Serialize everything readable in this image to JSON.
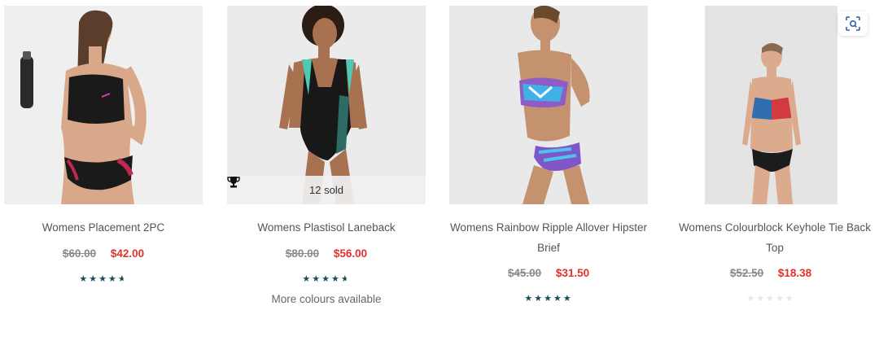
{
  "products": [
    {
      "name": "Womens Placement 2PC",
      "old_price": "$60.00",
      "new_price": "$42.00",
      "rating_stars": 4.5,
      "sold_badge": null,
      "extra_note": null
    },
    {
      "name": "Womens Plastisol Laneback",
      "old_price": "$80.00",
      "new_price": "$56.00",
      "rating_stars": 4.5,
      "sold_badge": "12 sold",
      "extra_note": "More colours available"
    },
    {
      "name": "Womens Rainbow Ripple Allover Hipster Brief",
      "old_price": "$45.00",
      "new_price": "$31.50",
      "rating_stars": 5,
      "sold_badge": null,
      "extra_note": null
    },
    {
      "name": "Womens Colourblock Keyhole Tie Back Top",
      "old_price": "$52.50",
      "new_price": "$18.38",
      "rating_stars": 0,
      "sold_badge": null,
      "extra_note": null
    }
  ],
  "icons": {
    "trophy": "trophy-icon",
    "visual_search": "visual-search-icon"
  },
  "colors": {
    "sale_price": "#e0322e",
    "old_price": "#8a8a8a",
    "star_filled": "#14505a",
    "star_empty": "#e6e6e6"
  }
}
